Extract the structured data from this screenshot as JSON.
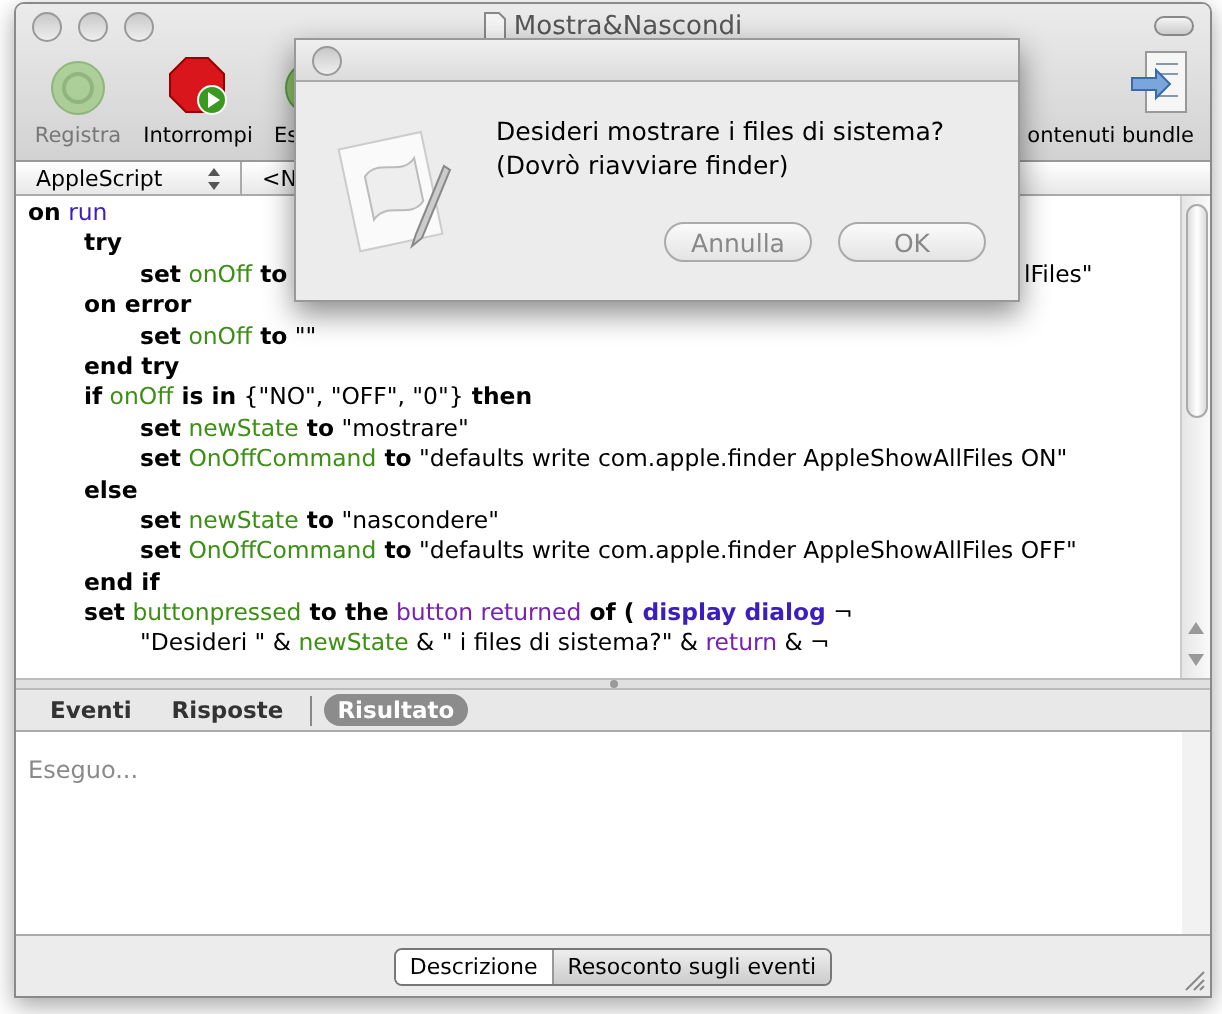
{
  "window": {
    "title": "Mostra&Nascondi"
  },
  "toolbar": [
    {
      "label": "Registra",
      "kind": "record",
      "disabled": true
    },
    {
      "label": "Intorrompi",
      "kind": "stop",
      "disabled": false
    },
    {
      "label": "Es",
      "kind": "run",
      "disabled": false
    }
  ],
  "bundle_button": {
    "label": "ontenuti bundle"
  },
  "navigation": {
    "language": "AppleScript",
    "handler": "<N"
  },
  "code": [
    {
      "tokens": [
        {
          "t": "on",
          "kind": "kw"
        },
        {
          "t": "run",
          "kind": "handler"
        }
      ],
      "children": [
        {
          "tokens": [
            {
              "t": "try",
              "kind": "kw"
            }
          ],
          "children": [
            {
              "tokens": [
                {
                  "t": "set",
                  "kind": "kw"
                },
                {
                  "t": "onOff",
                  "kind": "var"
                },
                {
                  "t": "to",
                  "kind": "kw"
                }
              ],
              "tail": "lFiles\""
            }
          ]
        },
        {
          "tokens": [
            {
              "t": "on error",
              "kind": "kw"
            }
          ],
          "children": [
            {
              "tokens": [
                {
                  "t": "set",
                  "kind": "kw"
                },
                {
                  "t": "onOff",
                  "kind": "var"
                },
                {
                  "t": "to",
                  "kind": "kw"
                },
                {
                  "t": "\"\"",
                  "kind": "plain"
                }
              ]
            }
          ]
        },
        {
          "tokens": [
            {
              "t": "end try",
              "kind": "kw"
            }
          ]
        },
        {
          "tokens": [
            {
              "t": "if",
              "kind": "kw"
            },
            {
              "t": "onOff",
              "kind": "var"
            },
            {
              "t": "is in",
              "kind": "kw"
            },
            {
              "t": "{\"NO\", \"OFF\", \"0\"}",
              "kind": "plain"
            },
            {
              "t": "then",
              "kind": "kw"
            }
          ],
          "children": [
            {
              "tokens": [
                {
                  "t": "set",
                  "kind": "kw"
                },
                {
                  "t": "newState",
                  "kind": "var"
                },
                {
                  "t": "to",
                  "kind": "kw"
                },
                {
                  "t": "\"mostrare\"",
                  "kind": "plain"
                }
              ]
            },
            {
              "tokens": [
                {
                  "t": "set",
                  "kind": "kw"
                },
                {
                  "t": "OnOffCommand",
                  "kind": "var"
                },
                {
                  "t": "to",
                  "kind": "kw"
                },
                {
                  "t": "\"defaults write com.apple.finder AppleShowAllFiles ON\"",
                  "kind": "plain"
                }
              ]
            }
          ]
        },
        {
          "tokens": [
            {
              "t": "else",
              "kind": "kw"
            }
          ],
          "children": [
            {
              "tokens": [
                {
                  "t": "set",
                  "kind": "kw"
                },
                {
                  "t": "newState",
                  "kind": "var"
                },
                {
                  "t": "to",
                  "kind": "kw"
                },
                {
                  "t": "\"nascondere\"",
                  "kind": "plain"
                }
              ]
            },
            {
              "tokens": [
                {
                  "t": "set",
                  "kind": "kw"
                },
                {
                  "t": "OnOffCommand",
                  "kind": "var"
                },
                {
                  "t": "to",
                  "kind": "kw"
                },
                {
                  "t": "\"defaults write com.apple.finder AppleShowAllFiles OFF\"",
                  "kind": "plain"
                }
              ]
            }
          ]
        },
        {
          "tokens": [
            {
              "t": "end if",
              "kind": "kw"
            }
          ]
        },
        {
          "tokens": [
            {
              "t": "set",
              "kind": "kw"
            },
            {
              "t": "buttonpressed",
              "kind": "var"
            },
            {
              "t": "to the",
              "kind": "kw"
            },
            {
              "t": "button returned",
              "kind": "app"
            },
            {
              "t": "of (",
              "kind": "kw"
            },
            {
              "t": "display dialog",
              "kind": "cmd"
            },
            {
              "t": "¬",
              "kind": "plain"
            }
          ],
          "children": [
            {
              "tokens": [
                {
                  "t": "\"Desideri \" &",
                  "kind": "plain"
                },
                {
                  "t": "newState",
                  "kind": "var"
                },
                {
                  "t": "& \" i files di sistema?\" &",
                  "kind": "plain"
                },
                {
                  "t": "return",
                  "kind": "app"
                },
                {
                  "t": "& ¬",
                  "kind": "plain"
                }
              ]
            }
          ]
        }
      ]
    }
  ],
  "result_tabs": [
    {
      "label": "Eventi",
      "selected": false
    },
    {
      "label": "Risposte",
      "selected": false
    },
    {
      "label": "Risultato",
      "selected": true
    }
  ],
  "result_text": "Eseguo...",
  "bottom_tabs": [
    {
      "label": "Descrizione",
      "selected": true
    },
    {
      "label": "Resoconto sugli eventi",
      "selected": false
    }
  ],
  "dialog": {
    "message": [
      "Desideri mostrare i files di sistema?",
      "(Dovrò riavviare finder)"
    ],
    "buttons": [
      "Annulla",
      "OK"
    ]
  }
}
